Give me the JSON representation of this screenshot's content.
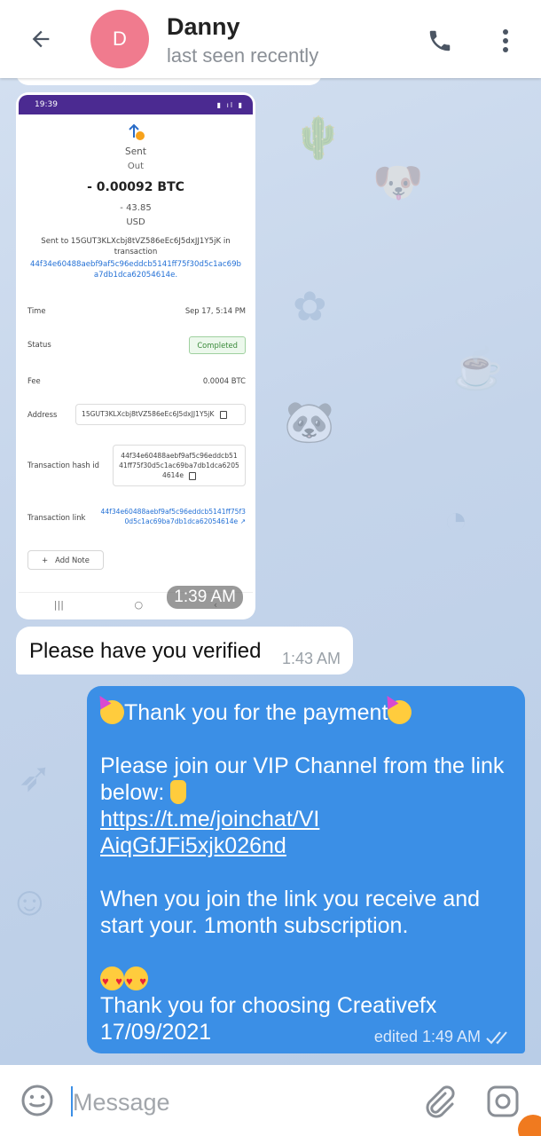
{
  "header": {
    "avatar_letter": "D",
    "name": "Danny",
    "status": "last seen recently"
  },
  "icons": {
    "back": "arrow-left-icon",
    "call": "phone-icon",
    "menu": "more-vertical-icon",
    "emoji": "smile-icon",
    "attach": "paperclip-icon",
    "camera": "camera-icon"
  },
  "image_message": {
    "time": "1:39 AM",
    "screenshot": {
      "status_time": "19:39",
      "direction": "Sent",
      "direction_sub": "Out",
      "amount": "- 0.00092 BTC",
      "usd_value": "- 43.85",
      "usd_unit": "USD",
      "sent_to_text": "Sent to 15GUT3KLXcbj8tVZ586eEc6J5dxJJ1Y5jK in transaction",
      "tx_link_text": "44f34e60488aebf9af5c96eddcb5141ff75f30d5c1ac69ba7db1dca62054614e.",
      "rows": {
        "time_label": "Time",
        "time_value": "Sep 17, 5:14 PM",
        "status_label": "Status",
        "status_value": "Completed",
        "fee_label": "Fee",
        "fee_value": "0.0004 BTC",
        "address_label": "Address",
        "address_value": "15GUT3KLXcbj8tVZ586eEc6J5dxJJ1Y5jK",
        "hash_label": "Transaction hash id",
        "hash_value": "44f34e60488aebf9af5c96eddcb5141ff75f30d5c1ac69ba7db1dca62054614e",
        "link_label": "Transaction link",
        "link_value": "44f34e60488aebf9af5c96eddcb5141ff75f30d5c1ac69ba7db1dca62054614e"
      },
      "add_note": "Add Note"
    }
  },
  "incoming_text": {
    "text": "Please have you verified",
    "time": "1:43 AM"
  },
  "outgoing": {
    "line1": "Thank you for the payment",
    "line2": "Please join our VIP Channel from the link below: ",
    "link": "https://t.me/joinchat/VIAiqGfJFi5xjk026nd",
    "line3": "When you join the link you receive and start your. 1month subscription.",
    "line4": "Thank you for choosing Creativefx 17/09/2021",
    "meta": "edited 1:49 AM"
  },
  "composer": {
    "placeholder": "Message"
  }
}
